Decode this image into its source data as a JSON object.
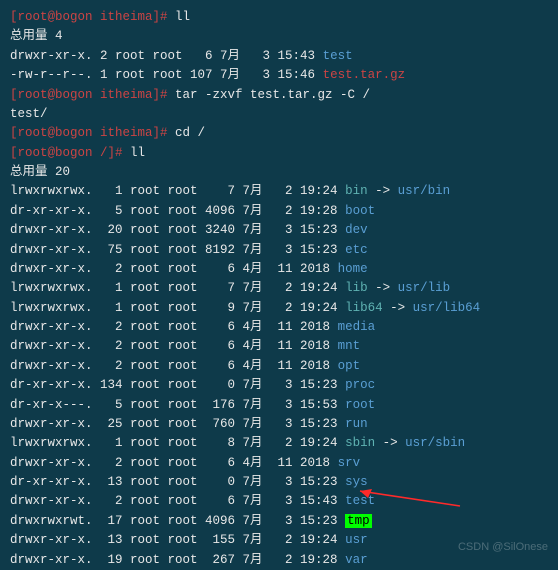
{
  "prompts": {
    "p1": "[root@bogon itheima]# ",
    "p2": "[root@bogon /]# "
  },
  "cmds": {
    "ll1": "ll",
    "tar": "tar -zxvf test.tar.gz -C /",
    "cd": "cd /",
    "ll2": "ll"
  },
  "totals": {
    "t1": "总用量 4",
    "t2": "总用量 20"
  },
  "tar_out": "test/",
  "ls1": [
    {
      "attrs": "drwxr-xr-x. 2 root root   6 7月   3 15:43 ",
      "name": "test",
      "cls": "blue"
    },
    {
      "attrs": "-rw-r--r--. 1 root root 107 7月   3 15:46 ",
      "name": "test.tar.gz",
      "cls": "red"
    }
  ],
  "ls2": [
    {
      "attrs": "lrwxrwxrwx.   1 root root    7 7月   2 19:24 ",
      "name": "bin",
      "cls": "cyan",
      "link_arrow": " -> ",
      "link": "usr/bin",
      "link_cls": "blue"
    },
    {
      "attrs": "dr-xr-xr-x.   5 root root 4096 7月   2 19:28 ",
      "name": "boot",
      "cls": "blue"
    },
    {
      "attrs": "drwxr-xr-x.  20 root root 3240 7月   3 15:23 ",
      "name": "dev",
      "cls": "blue"
    },
    {
      "attrs": "drwxr-xr-x.  75 root root 8192 7月   3 15:23 ",
      "name": "etc",
      "cls": "blue"
    },
    {
      "attrs": "drwxr-xr-x.   2 root root    6 4月  11 2018 ",
      "name": "home",
      "cls": "blue"
    },
    {
      "attrs": "lrwxrwxrwx.   1 root root    7 7月   2 19:24 ",
      "name": "lib",
      "cls": "cyan",
      "link_arrow": " -> ",
      "link": "usr/lib",
      "link_cls": "blue"
    },
    {
      "attrs": "lrwxrwxrwx.   1 root root    9 7月   2 19:24 ",
      "name": "lib64",
      "cls": "cyan",
      "link_arrow": " -> ",
      "link": "usr/lib64",
      "link_cls": "blue"
    },
    {
      "attrs": "drwxr-xr-x.   2 root root    6 4月  11 2018 ",
      "name": "media",
      "cls": "blue"
    },
    {
      "attrs": "drwxr-xr-x.   2 root root    6 4月  11 2018 ",
      "name": "mnt",
      "cls": "blue"
    },
    {
      "attrs": "drwxr-xr-x.   2 root root    6 4月  11 2018 ",
      "name": "opt",
      "cls": "blue"
    },
    {
      "attrs": "dr-xr-xr-x. 134 root root    0 7月   3 15:23 ",
      "name": "proc",
      "cls": "blue"
    },
    {
      "attrs": "dr-xr-x---.   5 root root  176 7月   3 15:53 ",
      "name": "root",
      "cls": "blue"
    },
    {
      "attrs": "drwxr-xr-x.  25 root root  760 7月   3 15:23 ",
      "name": "run",
      "cls": "blue"
    },
    {
      "attrs": "lrwxrwxrwx.   1 root root    8 7月   2 19:24 ",
      "name": "sbin",
      "cls": "cyan",
      "link_arrow": " -> ",
      "link": "usr/sbin",
      "link_cls": "blue"
    },
    {
      "attrs": "drwxr-xr-x.   2 root root    6 4月  11 2018 ",
      "name": "srv",
      "cls": "blue"
    },
    {
      "attrs": "dr-xr-xr-x.  13 root root    0 7月   3 15:23 ",
      "name": "sys",
      "cls": "blue"
    },
    {
      "attrs": "drwxr-xr-x.   2 root root    6 7月   3 15:43 ",
      "name": "test",
      "cls": "blue",
      "highlight": true
    },
    {
      "attrs": "drwxrwxrwt.  17 root root 4096 7月   3 15:23 ",
      "name": "tmp",
      "cls": "tmp"
    },
    {
      "attrs": "drwxr-xr-x.  13 root root  155 7月   2 19:24 ",
      "name": "usr",
      "cls": "blue"
    },
    {
      "attrs": "drwxr-xr-x.  19 root root  267 7月   2 19:28 ",
      "name": "var",
      "cls": "blue"
    }
  ],
  "watermark": "CSDN @SilOnese"
}
